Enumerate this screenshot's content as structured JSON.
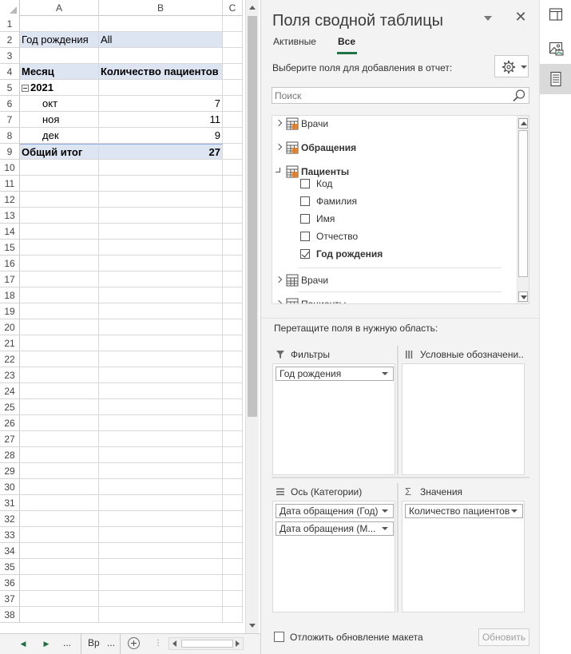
{
  "sheet": {
    "columns": [
      "A",
      "B",
      "C"
    ],
    "row_numbers": [
      "1",
      "2",
      "3",
      "4",
      "5",
      "6",
      "7",
      "8",
      "9",
      "10",
      "11",
      "12",
      "13",
      "14",
      "15",
      "16",
      "17",
      "18",
      "19",
      "20",
      "21",
      "22",
      "23",
      "24",
      "25",
      "26",
      "27",
      "28",
      "29",
      "30",
      "31",
      "32",
      "33",
      "34",
      "35",
      "36",
      "37",
      "38"
    ],
    "filter_label": "Год рождения",
    "filter_value": "All",
    "header_month": "Месяц",
    "header_count": "Количество пациентов",
    "year_label": "2021",
    "months": [
      {
        "name": "окт",
        "count": "7"
      },
      {
        "name": "ноя",
        "count": "11"
      },
      {
        "name": "дек",
        "count": "9"
      }
    ],
    "grand_total_label": "Общий итог",
    "grand_total_value": "27",
    "tab_dots_left": "...",
    "sheet_tab_label": "Вр",
    "tab_dots_right": "...",
    "add_sheet": "+",
    "tab_grip": "⋮"
  },
  "pane": {
    "title": "Поля сводной таблицы",
    "close": "✕",
    "tab_active": "Активные",
    "tab_all": "Все",
    "choose_label": "Выберите поля для добавления в отчет:",
    "search_placeholder": "Поиск",
    "tables": [
      {
        "name": "Врачи",
        "bold": false
      },
      {
        "name": "Обращения",
        "bold": true
      },
      {
        "name": "Пациенты",
        "bold": true
      },
      {
        "name": "Врачи",
        "bold": false
      },
      {
        "name": "Пациенты",
        "bold": false
      }
    ],
    "patient_fields": [
      {
        "name": "Код",
        "checked": false
      },
      {
        "name": "Фамилия",
        "checked": false
      },
      {
        "name": "Имя",
        "checked": false
      },
      {
        "name": "Отчество",
        "checked": false
      },
      {
        "name": "Год рождения",
        "checked": true
      }
    ],
    "drag_label": "Перетащите поля в нужную область:",
    "areas": {
      "filters": {
        "title": "Фильтры",
        "items": [
          "Год рождения"
        ]
      },
      "legend": {
        "title": "Условные обозначени...",
        "items": []
      },
      "axis": {
        "title": "Ось (Категории)",
        "items": [
          "Дата обращения (Год)",
          "Дата обращения (М..."
        ]
      },
      "values": {
        "title": "Значения",
        "items": [
          "Количество пациентов"
        ]
      }
    },
    "defer_label": "Отложить обновление макета",
    "update_button": "Обновить"
  },
  "colors": {
    "accent": "#217346",
    "pivot_header_bg": "#dde4f2",
    "pane_bg": "#f3f3f3",
    "table_icon_orange": "#e07b24"
  },
  "icons": {
    "strip": [
      "format-pane-icon",
      "image-icon",
      "field-list-icon"
    ]
  }
}
